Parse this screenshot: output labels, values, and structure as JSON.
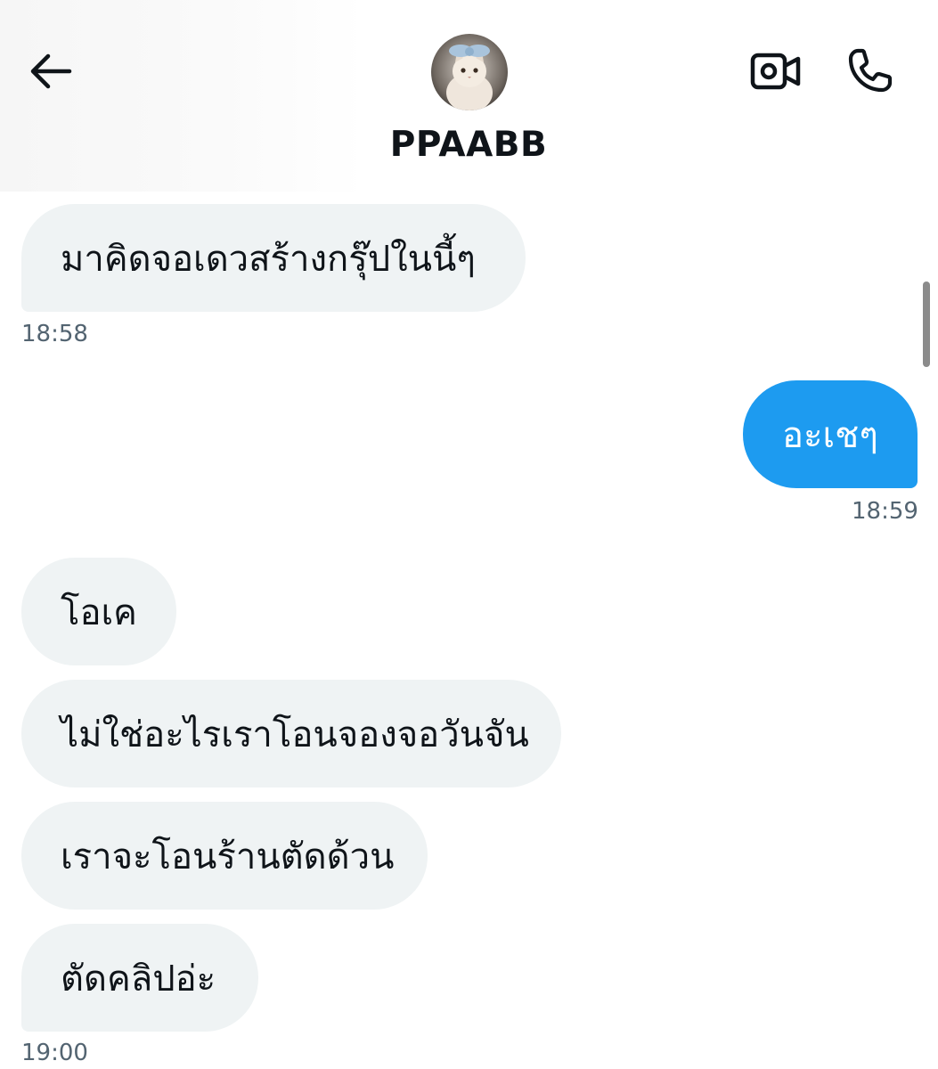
{
  "header": {
    "contact_name": "PPAABB",
    "back_icon": "arrow-left-icon",
    "video_icon": "video-camera-icon",
    "call_icon": "phone-icon"
  },
  "messages": [
    {
      "direction": "incoming",
      "text": "มาคิดจอเดวสร้างกรุ๊ปในนี้ๆ"
    },
    {
      "direction": "incoming",
      "time": "18:58"
    },
    {
      "direction": "outgoing",
      "text": "อะเชๆ"
    },
    {
      "direction": "outgoing",
      "time": "18:59"
    },
    {
      "direction": "incoming",
      "text": "โอเค"
    },
    {
      "direction": "incoming",
      "text": "ไม่ใช่อะไรเราโอนจองจอวันจัน"
    },
    {
      "direction": "incoming",
      "text": "เราจะโอนร้านตัดด้วน"
    },
    {
      "direction": "incoming",
      "text": "ตัดคลิปอ่ะ"
    },
    {
      "direction": "incoming",
      "time": "19:00"
    }
  ],
  "colors": {
    "incoming_bubble": "#eff3f4",
    "outgoing_bubble": "#1d9bf0",
    "timestamp": "#536471",
    "text": "#0f1419"
  }
}
